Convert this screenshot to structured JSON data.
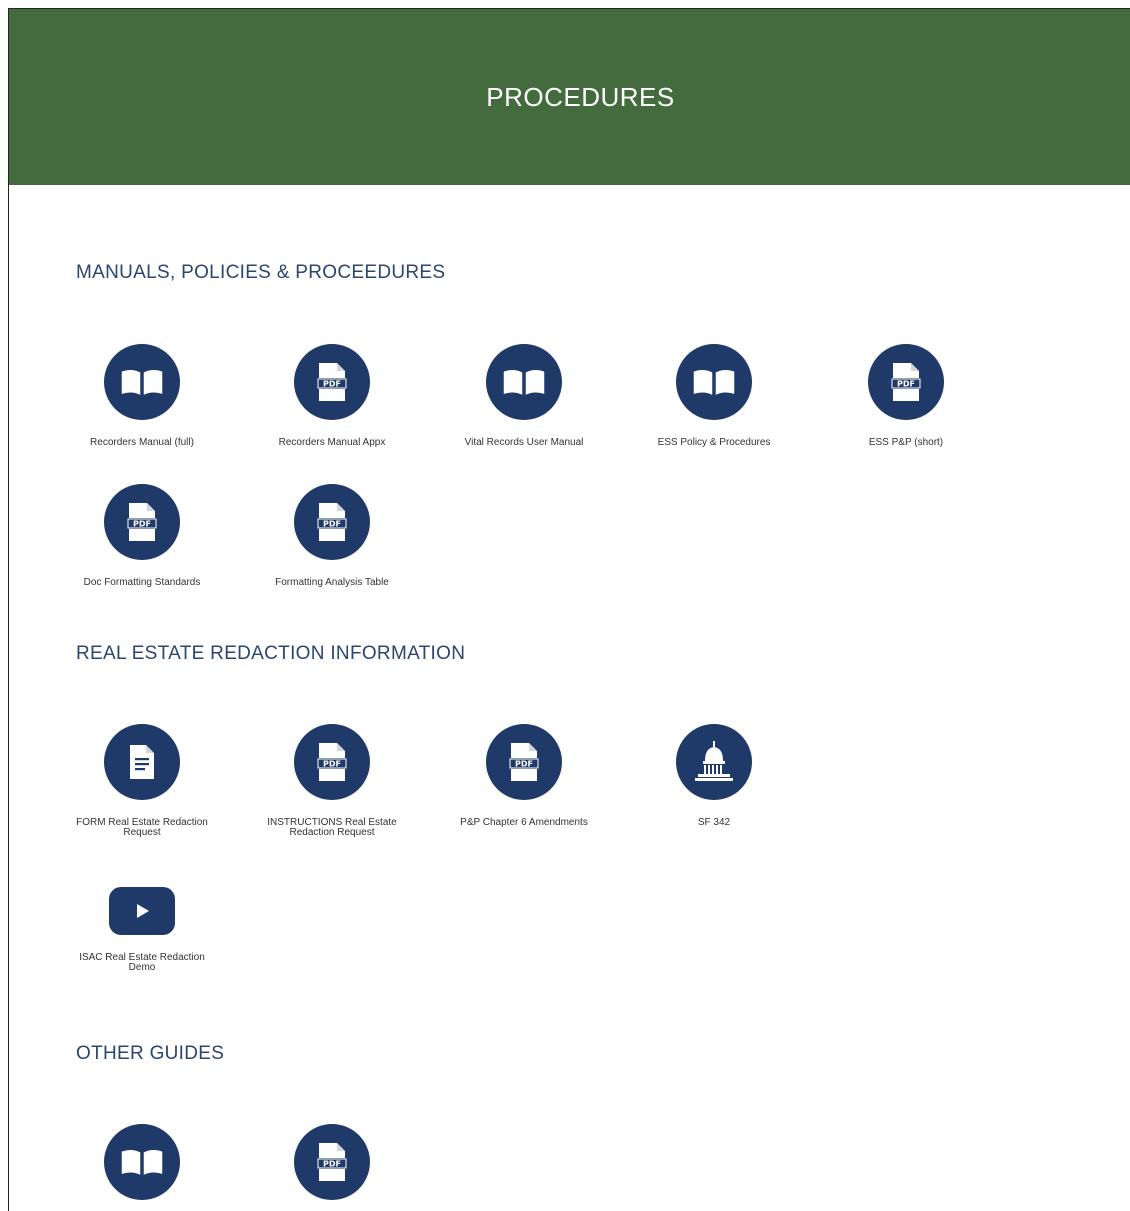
{
  "header": {
    "title": "PROCEDURES"
  },
  "sections": {
    "manuals": {
      "title": "MANUALS, POLICIES & PROCEEDURES",
      "items": [
        {
          "label": "Recorders Manual (full)",
          "icon": "book-icon"
        },
        {
          "label": "Recorders Manual Appx",
          "icon": "pdf-icon"
        },
        {
          "label": "Vital Records User Manual",
          "icon": "book-icon"
        },
        {
          "label": "ESS Policy & Procedures",
          "icon": "book-icon"
        },
        {
          "label": "ESS P&P (short)",
          "icon": "pdf-icon"
        },
        {
          "label": "Doc Formatting Standards",
          "icon": "pdf-icon"
        },
        {
          "label": "Formatting Analysis Table",
          "icon": "pdf-icon"
        }
      ]
    },
    "redaction": {
      "title": "REAL ESTATE REDACTION INFORMATION",
      "items": [
        {
          "label": "FORM Real Estate Redaction Request",
          "icon": "document-icon"
        },
        {
          "label": "INSTRUCTIONS Real Estate Redaction Request",
          "icon": "pdf-icon"
        },
        {
          "label": "P&P Chapter 6 Amendments",
          "icon": "pdf-icon"
        },
        {
          "label": "SF 342",
          "icon": "capitol-icon"
        },
        {
          "label": "ISAC Real Estate Redaction Demo",
          "icon": "youtube-icon"
        }
      ]
    },
    "guides": {
      "title": "OTHER GUIDES",
      "items": [
        {
          "label": "",
          "icon": "book-icon"
        },
        {
          "label": "",
          "icon": "pdf-icon"
        }
      ]
    }
  },
  "colors": {
    "banner": "#436b3e",
    "icon": "#1f3a68",
    "heading": "#2b4571"
  }
}
